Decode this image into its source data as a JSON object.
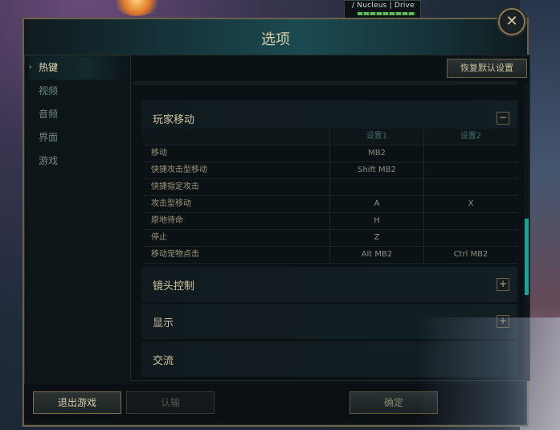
{
  "hud": {
    "player_label": "/ Nucleus | Drive"
  },
  "dialog": {
    "title": "选项",
    "close_glyph": "✕"
  },
  "sidebar": {
    "active_marker": "›",
    "items": [
      {
        "label": "热键",
        "active": true
      },
      {
        "label": "视频",
        "active": false
      },
      {
        "label": "音频",
        "active": false
      },
      {
        "label": "界面",
        "active": false
      },
      {
        "label": "游戏",
        "active": false
      }
    ]
  },
  "reset_button": "恢复默认设置",
  "sections": {
    "player_movement": {
      "title": "玩家移动",
      "toggle": "−",
      "columns": [
        "",
        "设置1",
        "设置2"
      ],
      "rows": [
        [
          "移动",
          "MB2",
          ""
        ],
        [
          "快捷攻击型移动",
          "Shift MB2",
          ""
        ],
        [
          "快捷指定攻击",
          "",
          ""
        ],
        [
          "攻击型移动",
          "A",
          "X"
        ],
        [
          "原地待命",
          "H",
          ""
        ],
        [
          "停止",
          "Z",
          ""
        ],
        [
          "移动宠物点击",
          "Alt MB2",
          "Ctrl MB2"
        ]
      ]
    },
    "camera": {
      "title": "镜头控制",
      "toggle": "+"
    },
    "display": {
      "title": "显示",
      "toggle": "+"
    },
    "communication": {
      "title": "交流"
    }
  },
  "footer": {
    "quit": "退出游戏",
    "surrender": "认输",
    "ok": "确定"
  },
  "colors": {
    "accent_teal": "#1aa19a",
    "gold_border": "#6b6146"
  }
}
